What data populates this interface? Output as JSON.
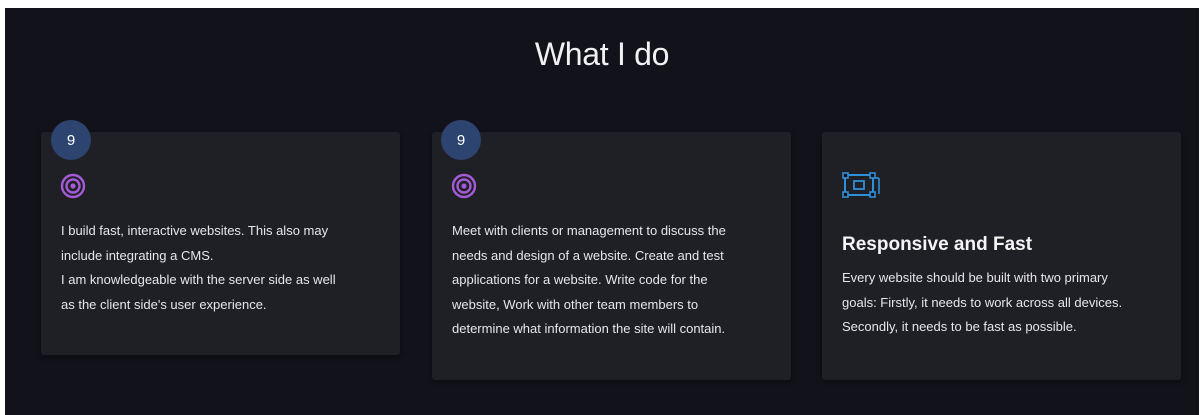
{
  "section": {
    "title": "What I do"
  },
  "colors": {
    "background": "#12121a",
    "card": "#1f1f26",
    "badge": "#2d4470",
    "target_icon": "#a45bd6",
    "responsive_icon": "#2f8fd8"
  },
  "cards": [
    {
      "badge": "9",
      "icon": "target-icon",
      "lines": [
        "I build fast, interactive websites. This also may",
        "include integrating a CMS.",
        "I am knowledgeable with the server side as well",
        "as the client side's user experience."
      ]
    },
    {
      "badge": "9",
      "icon": "target-icon",
      "lines": [
        "Meet with clients or management to discuss the",
        "needs and design of a website. Create and test",
        "applications for a website. Write code for the",
        "website, Work with other team members to",
        "determine what information the site will contain."
      ]
    },
    {
      "icon": "responsive-layout-icon",
      "heading": "Responsive and Fast",
      "lines": [
        "Every website should be built with two primary",
        "goals: Firstly, it needs to work across all devices.",
        "Secondly, it needs to be fast as possible."
      ]
    }
  ]
}
